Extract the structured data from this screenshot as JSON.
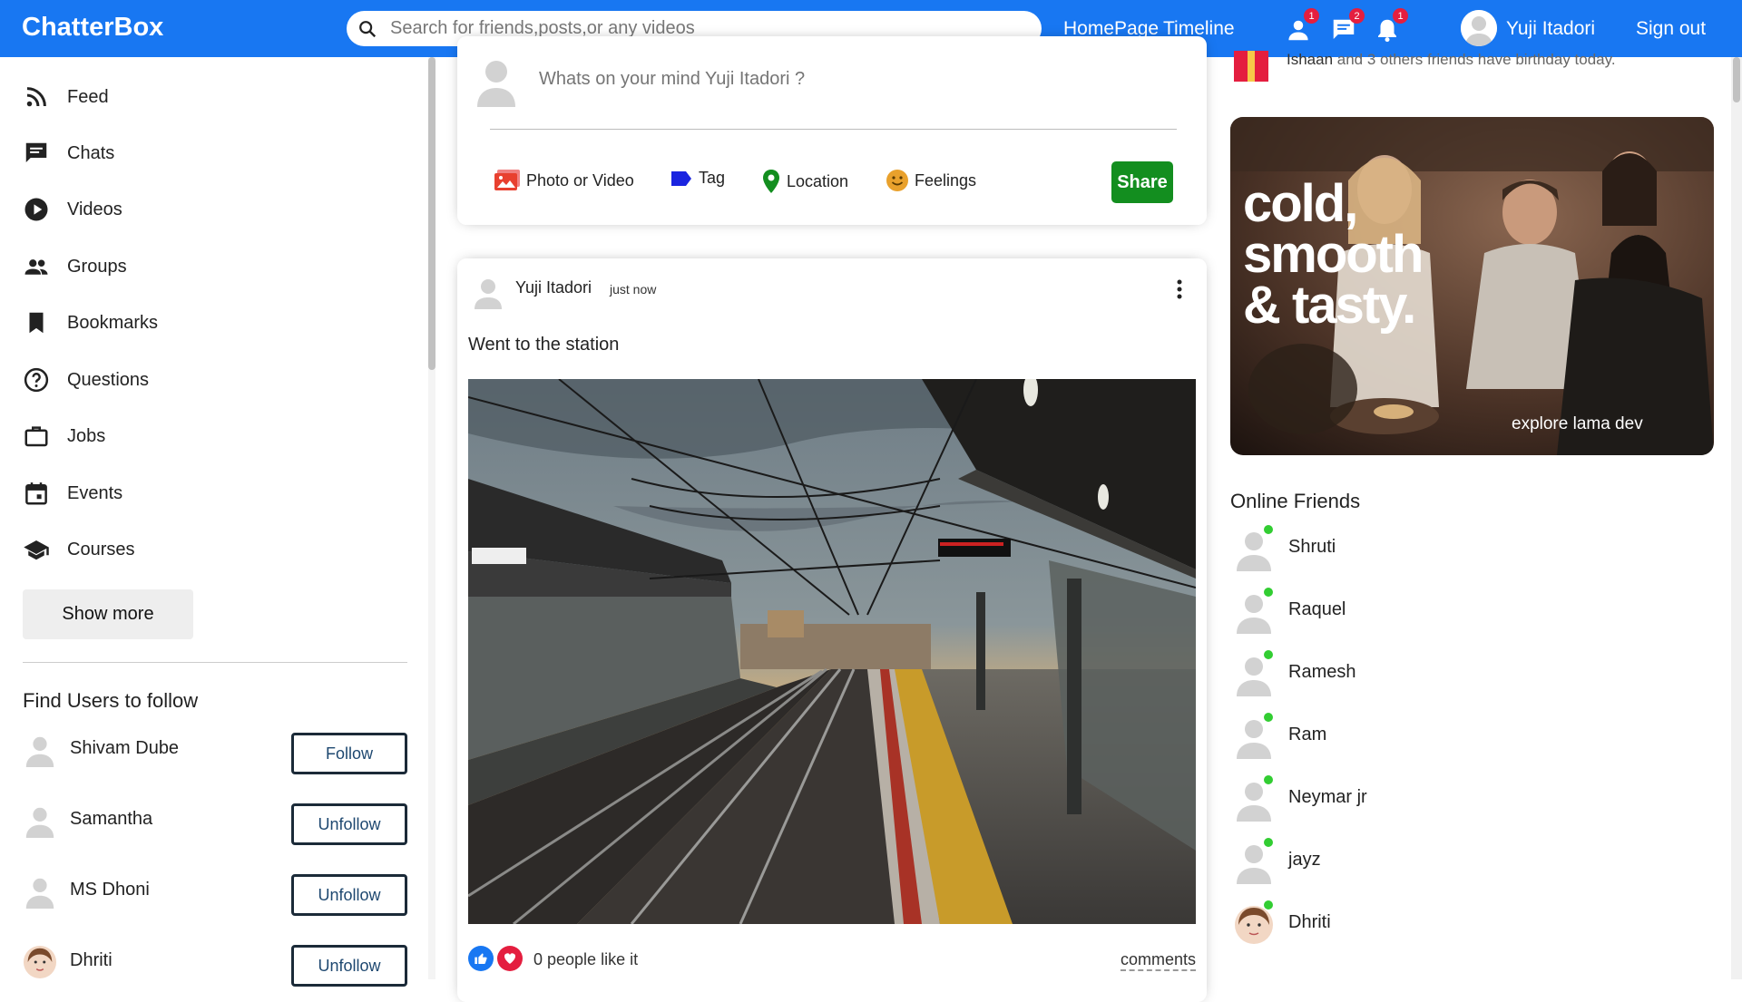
{
  "header": {
    "logo": "ChatterBox",
    "search_placeholder": "Search for friends,posts,or any videos",
    "links": {
      "home": "HomePage",
      "timeline": "Timeline"
    },
    "badges": {
      "friends": "1",
      "messages": "2",
      "notifications": "1"
    },
    "user_name": "Yuji Itadori",
    "sign_out": "Sign out"
  },
  "sidebar": {
    "items": [
      {
        "label": "Feed",
        "icon": "rss-feed-icon"
      },
      {
        "label": "Chats",
        "icon": "chat-icon"
      },
      {
        "label": "Videos",
        "icon": "play-circle-icon"
      },
      {
        "label": "Groups",
        "icon": "group-icon"
      },
      {
        "label": "Bookmarks",
        "icon": "bookmark-icon"
      },
      {
        "label": "Questions",
        "icon": "help-circle-icon"
      },
      {
        "label": "Jobs",
        "icon": "briefcase-icon"
      },
      {
        "label": "Events",
        "icon": "calendar-icon"
      },
      {
        "label": "Courses",
        "icon": "school-icon"
      }
    ],
    "show_more": "Show more",
    "find_title": "Find Users to follow",
    "users": [
      {
        "name": "Shivam Dube",
        "action": "Follow"
      },
      {
        "name": "Samantha",
        "action": "Unfollow"
      },
      {
        "name": "MS Dhoni",
        "action": "Unfollow"
      },
      {
        "name": "Dhriti",
        "action": "Unfollow"
      }
    ]
  },
  "share": {
    "placeholder": "Whats on your mind Yuji Itadori ?",
    "options": {
      "photo": "Photo or Video",
      "tag": "Tag",
      "location": "Location",
      "feelings": "Feelings"
    },
    "share_button": "Share"
  },
  "post": {
    "user": "Yuji Itadori",
    "time": "just now",
    "text": "Went to the station",
    "likes": "0 people like it",
    "comments": "comments"
  },
  "rightbar": {
    "birthday": {
      "name": "Ishaan",
      "text": " and 3 others friends have birthday today."
    },
    "ad": {
      "line1": "cold,",
      "line2": "smooth",
      "line3": "& tasty.",
      "footer": "explore lama dev"
    },
    "online_title": "Online Friends",
    "friends": [
      "Shruti",
      "Raquel",
      "Ramesh",
      "Ram",
      "Neymar jr",
      "jayz",
      "Dhriti"
    ]
  },
  "colors": {
    "topbar": "#1877f2",
    "share_button": "#138e1f",
    "online_dot": "#32cd32",
    "badge": "#e41e3f"
  }
}
